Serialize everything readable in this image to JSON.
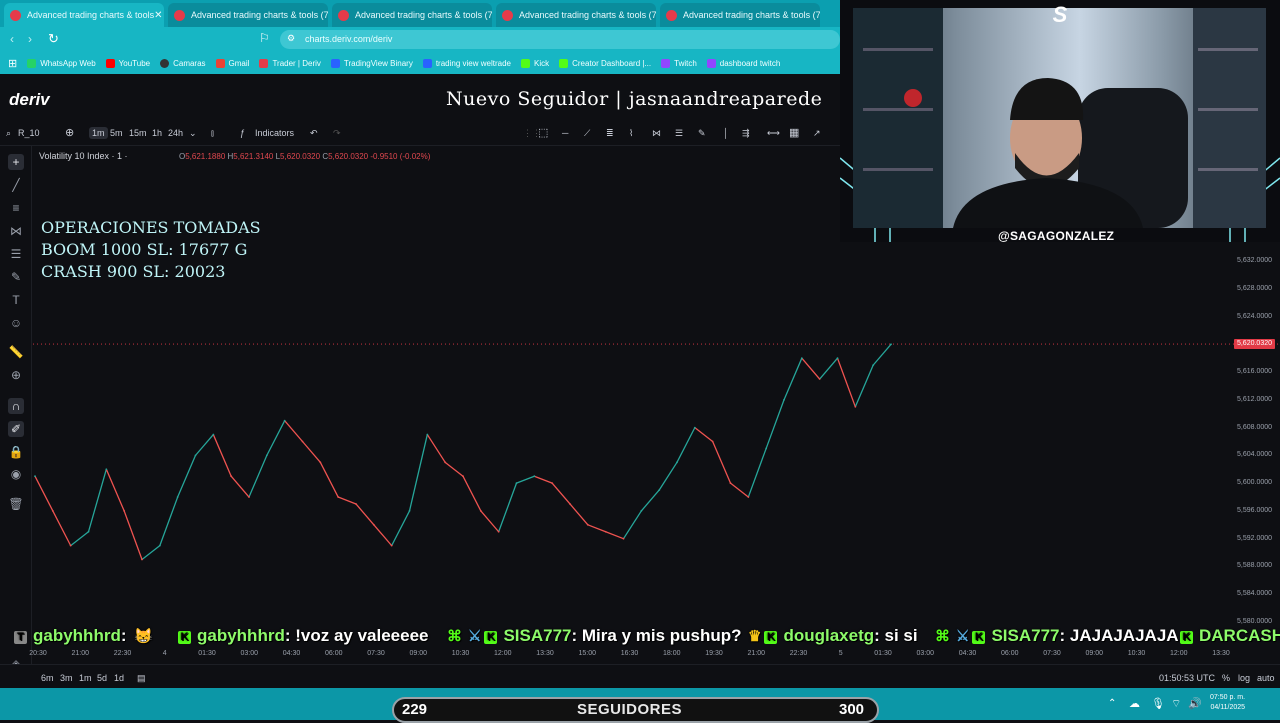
{
  "browser": {
    "tabs": [
      {
        "label": "Advanced trading charts & tools"
      },
      {
        "label": "Advanced trading charts & tools (7"
      },
      {
        "label": "Advanced trading charts & tools (7"
      },
      {
        "label": "Advanced trading charts & tools (7"
      },
      {
        "label": "Advanced trading charts & tools (7"
      }
    ],
    "url": "charts.deriv.com/deriv",
    "bookmarks": [
      "WhatsApp Web",
      "YouTube",
      "Camaras",
      "Gmail",
      "Trader | Deriv",
      "TradingView Binary",
      "trading view weltrade",
      "Kick",
      "Creator Dashboard |...",
      "Twitch",
      "dashboard twitch"
    ]
  },
  "header": {
    "logo": "deriv",
    "follower_alert": "Nuevo Seguidor | jasnaandreaparede"
  },
  "toolbar": {
    "symbol": "R_10",
    "intervals": [
      "1m",
      "5m",
      "15m",
      "1h",
      "24h"
    ],
    "selected_interval": "1m",
    "indicators_label": "Indicators"
  },
  "chart_legend": {
    "title": "Volatility 10 Index · 1 ·",
    "ohlc": {
      "o": "5,621.1880",
      "h": "5,621.3140",
      "l": "5,620.0320",
      "c": "5,620.0320",
      "change": "-0.9510 (-0.02%)"
    }
  },
  "overlay_text": {
    "line1": "OPERACIONES TOMADAS",
    "line2": "BOOM 1000 SL: 17677 G",
    "line3": "CRASH 900 SL: 20023"
  },
  "chart_data": {
    "type": "line",
    "title": "Volatility 10 Index · 1 ·",
    "xlabel": "",
    "ylabel": "",
    "x_ticks": [
      "20:30",
      "21:00",
      "22:30",
      "4",
      "01:30",
      "03:00",
      "04:30",
      "06:00",
      "07:30",
      "09:00",
      "10:30",
      "12:00",
      "13:30",
      "15:00",
      "16:30",
      "18:00",
      "19:30",
      "21:00",
      "22:30",
      "5",
      "01:30",
      "03:00",
      "04:30",
      "06:00",
      "07:30",
      "09:00",
      "10:30",
      "12:00",
      "13:30"
    ],
    "y_ticks": [
      "5,632.0000",
      "5,628.0000",
      "5,624.0000",
      "5,620.0000",
      "5,616.0000",
      "5,612.0000",
      "5,608.0000",
      "5,604.0000",
      "5,600.0000",
      "5,596.0000",
      "5,592.0000",
      "5,588.0000",
      "5,584.0000",
      "5,580.0000"
    ],
    "ylim": [
      5580,
      5632
    ],
    "current_price": "5,620.0320",
    "series": [
      {
        "values": [
          5601,
          5596,
          5591,
          5593,
          5602,
          5596,
          5589,
          5591,
          5598,
          5604,
          5607,
          5601,
          5598,
          5604,
          5609,
          5606,
          5603,
          5598,
          5597,
          5594,
          5591,
          5596,
          5607,
          5603,
          5601,
          5596,
          5593,
          5600,
          5601,
          5600,
          5597,
          5594,
          5593,
          5592,
          5596,
          5599,
          5603,
          5608,
          5606,
          5600,
          5598,
          5605,
          5612,
          5618,
          5615,
          5618,
          5611,
          5617,
          5620
        ]
      }
    ]
  },
  "bottom_bar": {
    "ranges": [
      "6m",
      "3m",
      "1m",
      "5d",
      "1d"
    ],
    "clock_utc": "01:50:53 UTC",
    "percent": "%",
    "log": "log",
    "auto": "auto"
  },
  "chat": [
    {
      "user": "gabyhhhrd",
      "message": ""
    },
    {
      "user": "gabyhhhrd",
      "message": "!voz ay valeeeee"
    },
    {
      "user": "SISA777",
      "message": "Mira y mis pushup?"
    },
    {
      "user": "douglaxetg",
      "message": "si si"
    },
    {
      "user": "SISA777",
      "message": "JAJAJAJAJA"
    },
    {
      "user": "DARCASH",
      "message": ""
    }
  ],
  "webcam": {
    "handle": "@SAGAGONZALEZ",
    "logo": "S"
  },
  "follower_goal": {
    "current": "229",
    "label": "SEGUIDORES",
    "goal": "300"
  },
  "taskbar": {
    "time": "07:50 p. m.",
    "date": "04/11/2025"
  },
  "colors": {
    "up": "#26a69a",
    "down": "#ef5350",
    "price_tag": "#e23a46",
    "chrome": "#17b6c4"
  }
}
